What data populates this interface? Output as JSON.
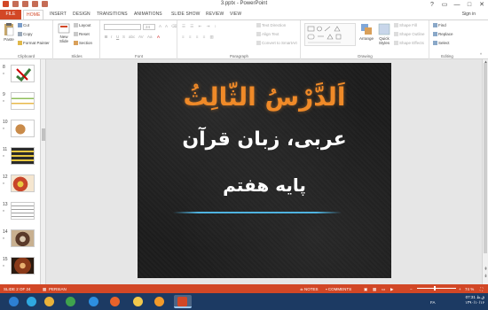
{
  "window": {
    "title": "3.pptx - PowerPoint",
    "controls": [
      "?",
      "▭",
      "—",
      "□",
      "✕"
    ],
    "sign_in": "Sign in"
  },
  "tabs": [
    {
      "label": "FILE",
      "kind": "file"
    },
    {
      "label": "HOME",
      "kind": "active"
    },
    {
      "label": "INSERT"
    },
    {
      "label": "DESIGN"
    },
    {
      "label": "TRANSITIONS"
    },
    {
      "label": "ANIMATIONS"
    },
    {
      "label": "SLIDE SHOW"
    },
    {
      "label": "REVIEW"
    },
    {
      "label": "VIEW"
    }
  ],
  "ribbon": {
    "clipboard": {
      "paste": "Paste",
      "cut": "Cut",
      "copy": "Copy",
      "format_painter": "Format Painter",
      "label": "Clipboard"
    },
    "slides": {
      "new_slide": "New Slide",
      "layout": "Layout",
      "reset": "Reset",
      "section": "Section",
      "label": "Slides"
    },
    "font": {
      "label": "Font",
      "font_size": "24"
    },
    "paragraph": {
      "text_direction": "Text Direction",
      "align_text": "Align Text",
      "convert_smartart": "Convert to SmartArt",
      "label": "Paragraph"
    },
    "drawing": {
      "arrange": "Arrange",
      "quick_styles": "Quick Styles",
      "shape_fill": "Shape Fill",
      "shape_outline": "Shape Outline",
      "shape_effects": "Shape Effects",
      "label": "Drawing"
    },
    "editing": {
      "find": "Find",
      "replace": "Replace",
      "select": "Select",
      "label": "Editing"
    }
  },
  "thumbnails": [
    {
      "num": "8",
      "star": "*",
      "color": "#3a7a3a"
    },
    {
      "num": "9",
      "star": "*",
      "color": "#8fbf5a"
    },
    {
      "num": "10",
      "star": "*",
      "color": "#c98b4a"
    },
    {
      "num": "11",
      "star": "*",
      "color": "#2a2a2a"
    },
    {
      "num": "12",
      "star": "*",
      "color": "#c8452a"
    },
    {
      "num": "13",
      "star": "*",
      "color": "#a0a0a0"
    },
    {
      "num": "14",
      "star": "*",
      "color": "#5a3a2a"
    },
    {
      "num": "15",
      "star": "*",
      "color": "#8a3a1a"
    }
  ],
  "slide": {
    "title": "اَلدَّرْسُ الثّالِثُ",
    "subtitle": "عربی، زبان قرآن",
    "grade": "پایه هفتم",
    "line_color": "#4fb3e0",
    "title_color": "#f08a28"
  },
  "status": {
    "slide_of": "SLIDE 2 OF 24",
    "language": "PERSIAN",
    "notes": "NOTES",
    "comments": "COMMENTS",
    "zoom": "74 %",
    "zoom_fraction": 0.45
  },
  "taskbar": {
    "apps": [
      {
        "name": "start-icon",
        "color": "#2d7fd3"
      },
      {
        "name": "telegram-icon",
        "color": "#2fa8e0"
      },
      {
        "name": "chrome-icon",
        "color": "#e8b23a"
      },
      {
        "name": "edge-icon",
        "color": "#3fa34d"
      },
      {
        "name": "ie-icon",
        "color": "#2d8fe0"
      },
      {
        "name": "firefox-icon",
        "color": "#e8622a"
      },
      {
        "name": "explorer-icon",
        "color": "#f2c94c"
      },
      {
        "name": "media-player-icon",
        "color": "#f29a2a"
      },
      {
        "name": "powerpoint-icon",
        "color": "#d24726"
      }
    ],
    "time": "07:31 ق.ظ",
    "date": "۱۳۹۰/۱۰/۱۶",
    "lang": "FA"
  }
}
